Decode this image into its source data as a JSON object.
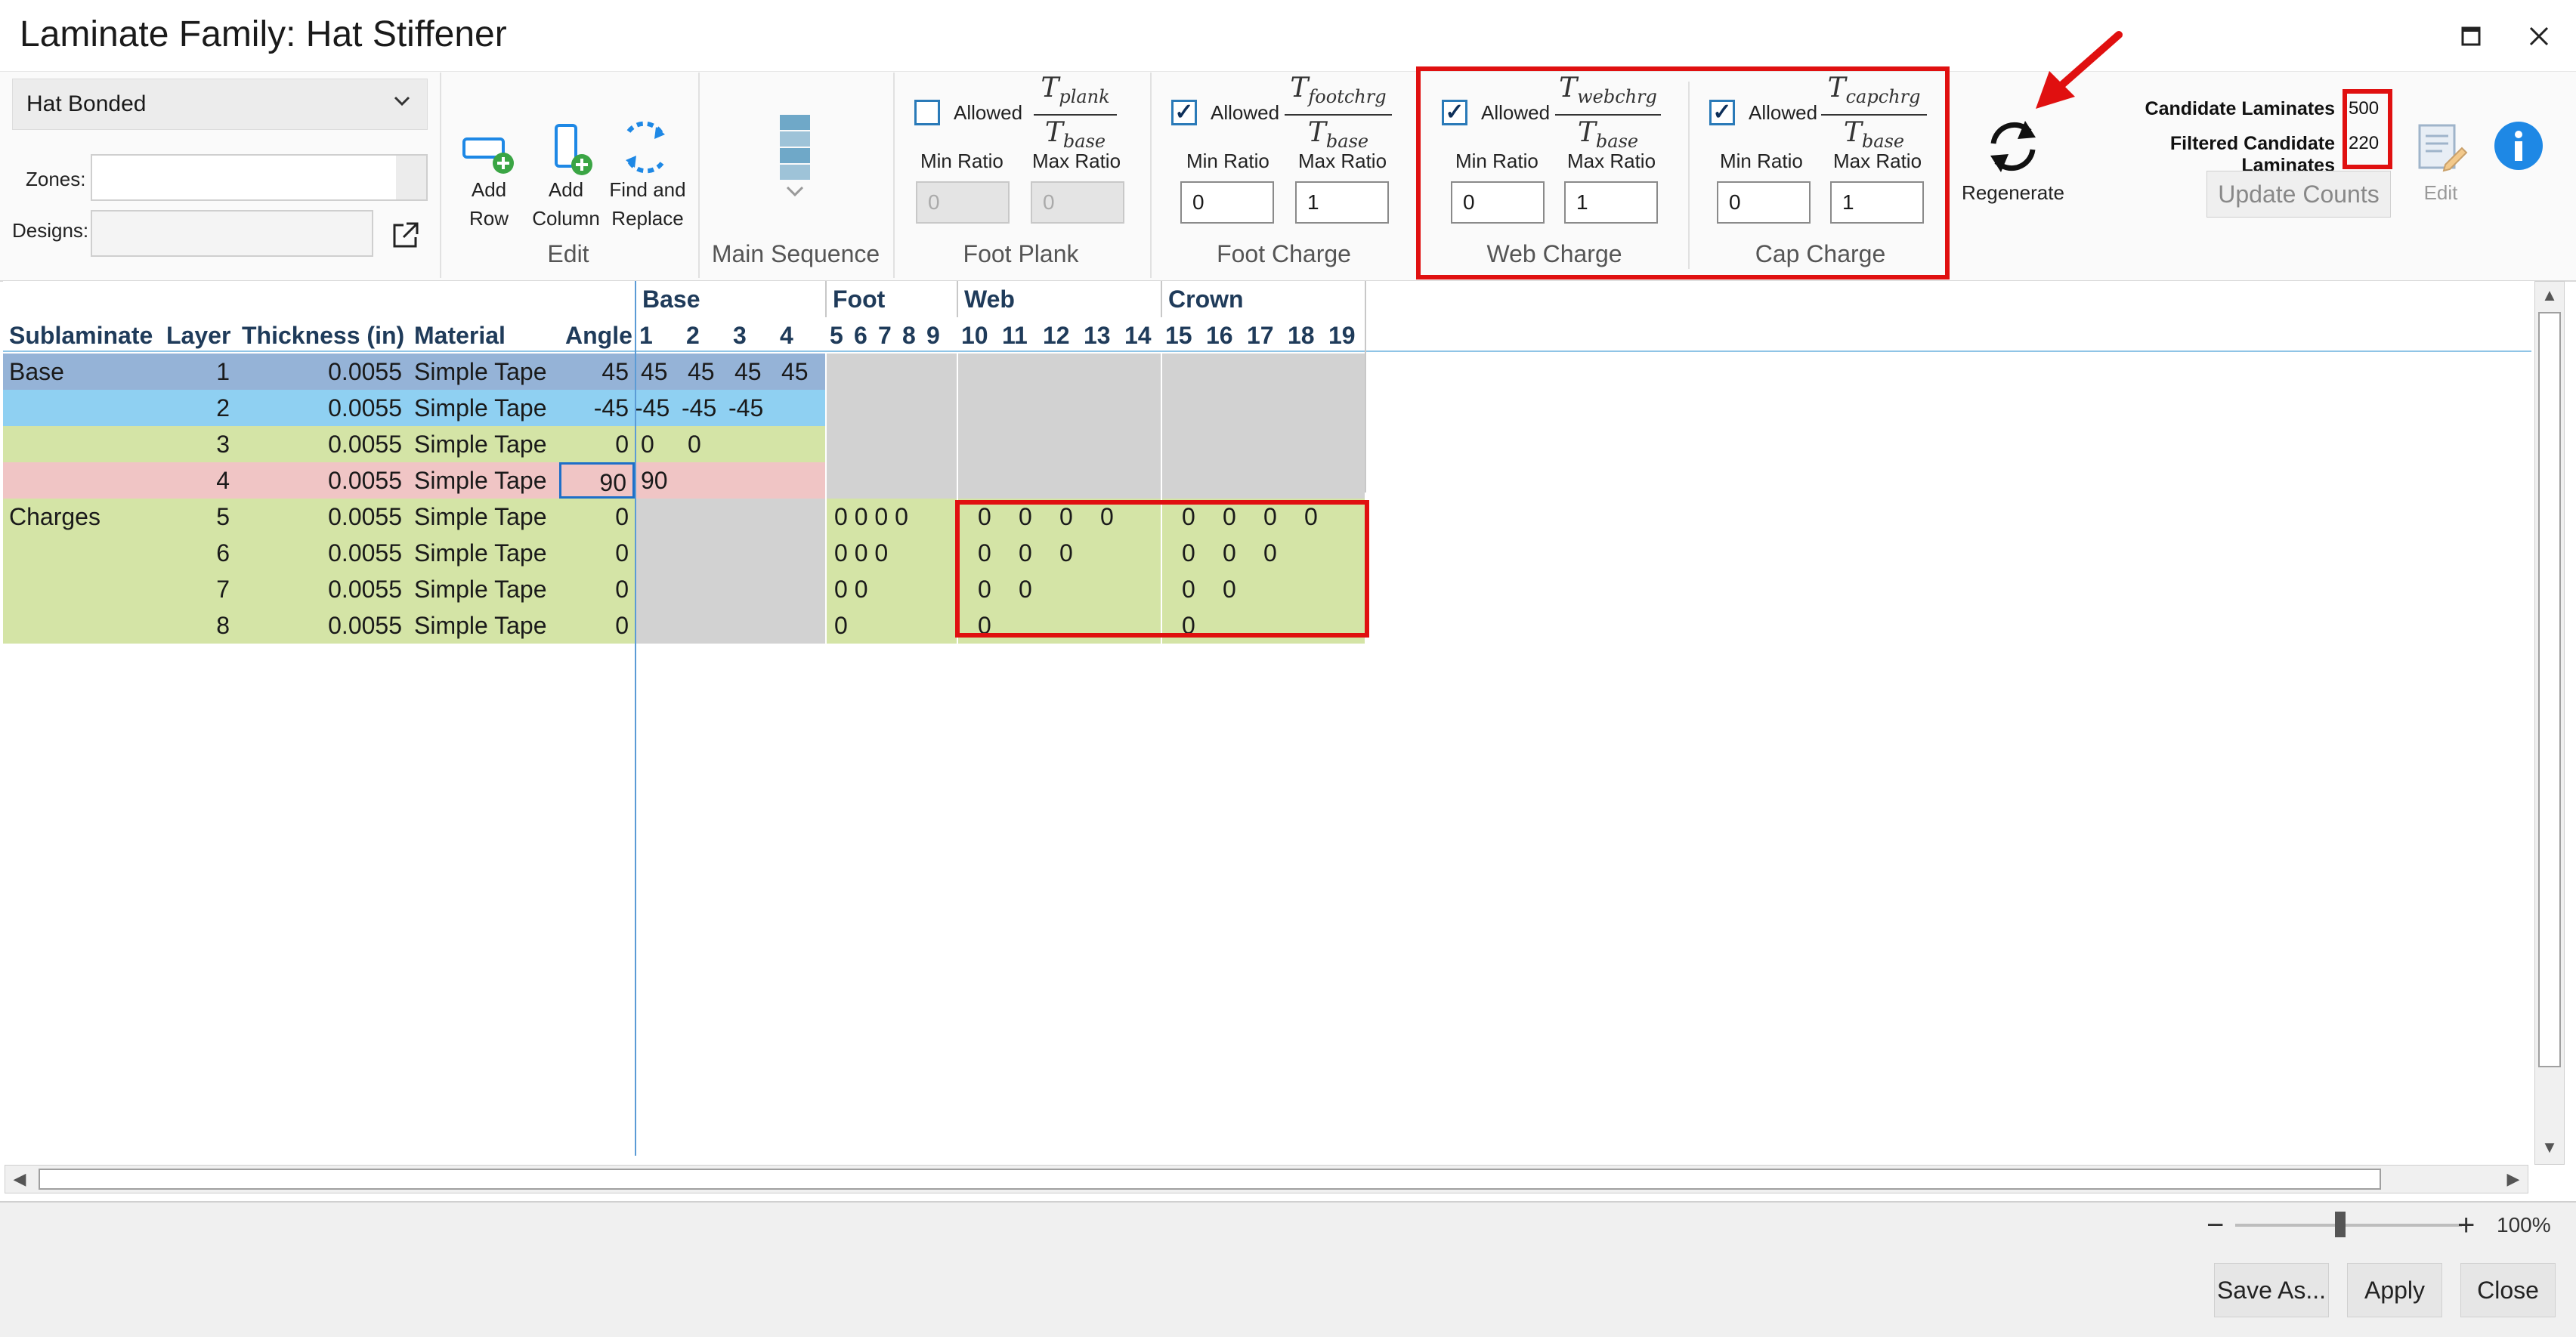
{
  "window": {
    "title": "Laminate Family: Hat Stiffener",
    "maximize_glyph": "🗖",
    "close_glyph": "✕"
  },
  "ribbon": {
    "family_select": {
      "value": "Hat Bonded"
    },
    "zones_label": "Zones:",
    "designs_label": "Designs:",
    "edit_group": {
      "label": "Edit",
      "add_row": "Add\nRow",
      "add_column": "Add\nColumn",
      "find_replace": "Find and\nReplace"
    },
    "main_sequence": {
      "label": "Main Sequence"
    },
    "foot_plank": {
      "label": "Foot Plank",
      "allowed_label": "Allowed",
      "allowed": false,
      "num": "plank",
      "den": "base",
      "min_label": "Min Ratio",
      "max_label": "Max Ratio",
      "min": "0",
      "max": "0"
    },
    "foot_charge": {
      "label": "Foot Charge",
      "allowed_label": "Allowed",
      "allowed": true,
      "num": "footchrg",
      "den": "base",
      "min_label": "Min Ratio",
      "max_label": "Max Ratio",
      "min": "0",
      "max": "1"
    },
    "web_charge": {
      "label": "Web Charge",
      "allowed_label": "Allowed",
      "allowed": true,
      "num": "webchrg",
      "den": "base",
      "min_label": "Min Ratio",
      "max_label": "Max Ratio",
      "min": "0",
      "max": "1"
    },
    "cap_charge": {
      "label": "Cap Charge",
      "allowed_label": "Allowed",
      "allowed": true,
      "num": "capchrg",
      "den": "base",
      "min_label": "Min Ratio",
      "max_label": "Max Ratio",
      "min": "0",
      "max": "1"
    },
    "regenerate": "Regenerate",
    "candidate_label": "Candidate Laminates",
    "candidate_value": "500",
    "filtered_label": "Filtered Candidate Laminates",
    "filtered_value": "220",
    "update_counts": "Update Counts",
    "edit_label": "Edit"
  },
  "grid": {
    "group_headers": {
      "base": "Base",
      "foot": "Foot",
      "web": "Web",
      "crown": "Crown"
    },
    "columns": {
      "sublaminate": "Sublaminate",
      "layer": "Layer",
      "thickness": "Thickness (in)",
      "material": "Material",
      "angle": "Angle"
    },
    "col_numbers": [
      "1",
      "2",
      "3",
      "4",
      "5",
      "6",
      "7",
      "8",
      "9",
      "10",
      "11",
      "12",
      "13",
      "14",
      "15",
      "16",
      "17",
      "18",
      "19"
    ],
    "rows": [
      {
        "sub": "Base",
        "layer": "1",
        "thick": "0.0055",
        "mat": "Simple Tape",
        "angle": "45",
        "base": [
          "45",
          "45",
          "45",
          "45"
        ],
        "foot": "",
        "web": [],
        "crown": []
      },
      {
        "sub": "",
        "layer": "2",
        "thick": "0.0055",
        "mat": "Simple Tape",
        "angle": "-45",
        "base": [
          "-45",
          "-45",
          "-45",
          ""
        ],
        "foot": "",
        "web": [],
        "crown": []
      },
      {
        "sub": "",
        "layer": "3",
        "thick": "0.0055",
        "mat": "Simple Tape",
        "angle": "0",
        "base": [
          "0",
          "0",
          "",
          ""
        ],
        "foot": "",
        "web": [],
        "crown": []
      },
      {
        "sub": "",
        "layer": "4",
        "thick": "0.0055",
        "mat": "Simple Tape",
        "angle": "90",
        "base": [
          "90",
          "",
          "",
          ""
        ],
        "foot": "",
        "web": [],
        "crown": []
      },
      {
        "sub": "Charges",
        "layer": "5",
        "thick": "0.0055",
        "mat": "Simple Tape",
        "angle": "0",
        "base": [],
        "foot": "0 0 0 0",
        "web": [
          "0",
          "0",
          "0",
          "0"
        ],
        "crown": [
          "0",
          "0",
          "0",
          "0"
        ]
      },
      {
        "sub": "",
        "layer": "6",
        "thick": "0.0055",
        "mat": "Simple Tape",
        "angle": "0",
        "base": [],
        "foot": "0 0 0",
        "web": [
          "0",
          "0",
          "0"
        ],
        "crown": [
          "0",
          "0",
          "0"
        ]
      },
      {
        "sub": "",
        "layer": "7",
        "thick": "0.0055",
        "mat": "Simple Tape",
        "angle": "0",
        "base": [],
        "foot": "0 0",
        "web": [
          "0",
          "0"
        ],
        "crown": [
          "0",
          "0"
        ]
      },
      {
        "sub": "",
        "layer": "8",
        "thick": "0.0055",
        "mat": "Simple Tape",
        "angle": "0",
        "base": [],
        "foot": "0",
        "web": [
          "0"
        ],
        "crown": [
          "0"
        ]
      }
    ]
  },
  "status": {
    "zoom": "100%",
    "minus": "−",
    "plus": "+",
    "save_as": "Save As...",
    "apply": "Apply",
    "close": "Close"
  },
  "colors": {
    "highlight_red": "#e01010",
    "row_base_1": "#95b3d7",
    "row_base_2": "#8fd0f2",
    "row_green": "#d4e4a6",
    "row_pink": "#f0c5c5",
    "cell_gray": "#d2d2d2",
    "accent_blue": "#1e88e5"
  }
}
